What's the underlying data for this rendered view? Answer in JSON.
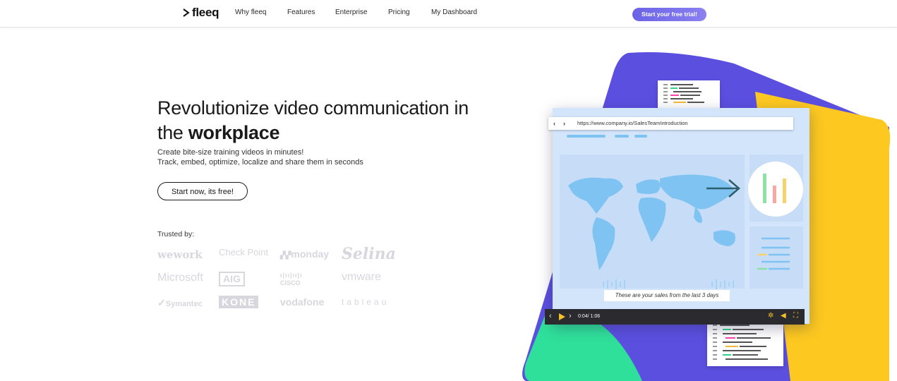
{
  "nav": {
    "logo_text": "fleeq",
    "links": [
      "Why fleeq",
      "Features",
      "Enterprise",
      "Pricing",
      "My Dashboard"
    ],
    "cta_label": "Start your free trial!"
  },
  "hero": {
    "title_line1": "Revolutionize video communication in",
    "title_line2_prefix": "the ",
    "title_line2_bold": "workplace",
    "subtitle_line1": "Create bite-size training videos in minutes!",
    "subtitle_line2": "Track, embed, optimize, localize and share them in seconds",
    "start_button": "Start now, its free!"
  },
  "trusted": {
    "label": "Trusted by:",
    "brands": [
      "wework",
      "Check Point",
      "monday",
      "Selina",
      "Microsoft",
      "AIG",
      "CISCO",
      "vmware",
      "Symantec",
      "KONE",
      "vodafone",
      "tableau"
    ]
  },
  "illustration": {
    "url": "https://www.company.io/SalesTeamIntroduction",
    "caption": "These are your sales from the last 3 days",
    "time": "0:04/ 1:06",
    "colors": {
      "purple": "#5b4fe0",
      "yellow": "#fdc820",
      "green": "#2fe09a",
      "screen": "#cfe2fa",
      "map": "#7fc3f3"
    }
  }
}
